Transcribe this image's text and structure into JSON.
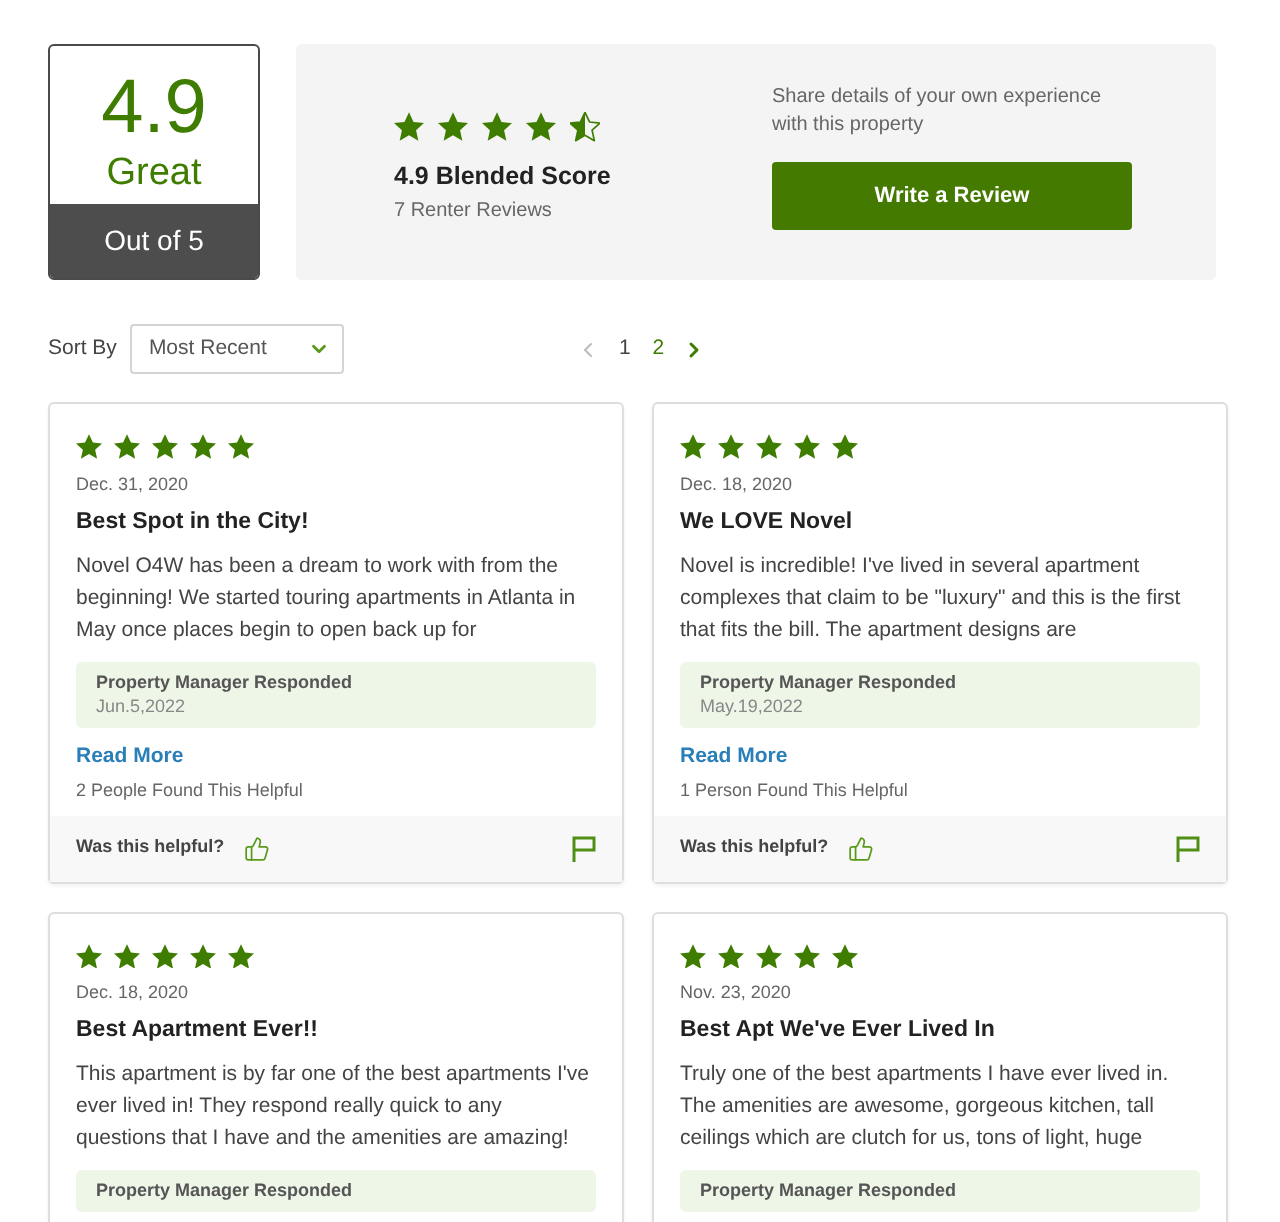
{
  "rating_summary": {
    "score": "4.9",
    "label": "Great",
    "scale": "Out of 5"
  },
  "blended": {
    "stars": 4.5,
    "score_text": "4.9 Blended Score",
    "count": "7 Renter Reviews"
  },
  "write_review": {
    "prompt": "Share details of your own experience with this property",
    "button": "Write a Review"
  },
  "sort": {
    "label": "Sort By",
    "value": "Most Recent"
  },
  "pagination": {
    "prev": {
      "disabled": true
    },
    "pages": [
      {
        "label": "1",
        "selected": true
      },
      {
        "label": "2",
        "selected": false
      }
    ],
    "next": {
      "disabled": false
    }
  },
  "reviews": [
    {
      "stars": 5,
      "date": "Dec. 31, 2020",
      "title": "Best Spot in the City!",
      "body": "Novel O4W has been a dream to work with from the beginning! We started touring apartments in Atlanta in May once places begin to open back up for",
      "response": {
        "title": "Property Manager Responded",
        "date": "Jun.5,2022"
      },
      "read_more": "Read More",
      "helpful_count": "2 People Found This Helpful",
      "helpful_prompt": "Was this helpful?"
    },
    {
      "stars": 5,
      "date": "Dec. 18, 2020",
      "title": "We LOVE Novel",
      "body": "Novel is incredible! I've lived in several apartment complexes that claim to be \"luxury\" and this is the first that fits the bill. The apartment designs are",
      "response": {
        "title": "Property Manager Responded",
        "date": "May.19,2022"
      },
      "read_more": "Read More",
      "helpful_count": "1 Person Found This Helpful",
      "helpful_prompt": "Was this helpful?"
    },
    {
      "stars": 5,
      "date": "Dec. 18, 2020",
      "title": "Best Apartment Ever!!",
      "body": "This apartment is by far one of the best apartments I've ever lived in! They respond really quick to any questions that I have and the amenities are amazing!",
      "response": {
        "title": "Property Manager Responded"
      }
    },
    {
      "stars": 5,
      "date": "Nov. 23, 2020",
      "title": "Best Apt We've Ever Lived In",
      "body": "Truly one of the best apartments I have ever lived in. The amenities are awesome, gorgeous kitchen, tall ceilings which are clutch for us, tons of light, huge",
      "response": {
        "title": "Property Manager Responded"
      }
    }
  ]
}
